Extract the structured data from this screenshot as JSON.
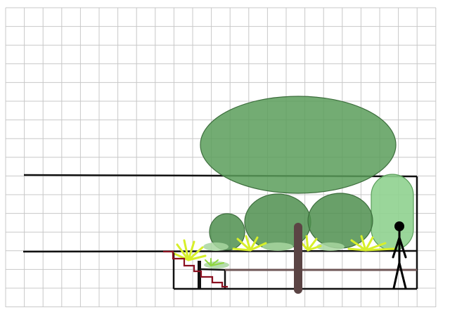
{
  "diagram": {
    "colors": {
      "background": "#ffffff",
      "grid": "#c8c8c8",
      "structure_line": "#111111",
      "canopy_large": "#5a9e5a",
      "canopy_outline": "#3d6e3d",
      "canopy_dark": "#4f8f4f",
      "canopy_light": "#8fd18f",
      "trunk": "#5b4444",
      "beam": "#6e5656",
      "fern_yellow": "#d7ef2a",
      "fern_green": "#8fd640",
      "groundcover": "#a8d6a0",
      "stair": "#8a1020",
      "figure": "#000000"
    },
    "elements": {
      "grid": "grid-background",
      "upper_line": "upper-level-line",
      "lower_line": "ground-level-line",
      "planter": "planter-box",
      "tree": "tree",
      "shrubs": "shrub-group",
      "ferns": "fern-group",
      "stairs": "stairs",
      "person": "person-figure"
    }
  }
}
